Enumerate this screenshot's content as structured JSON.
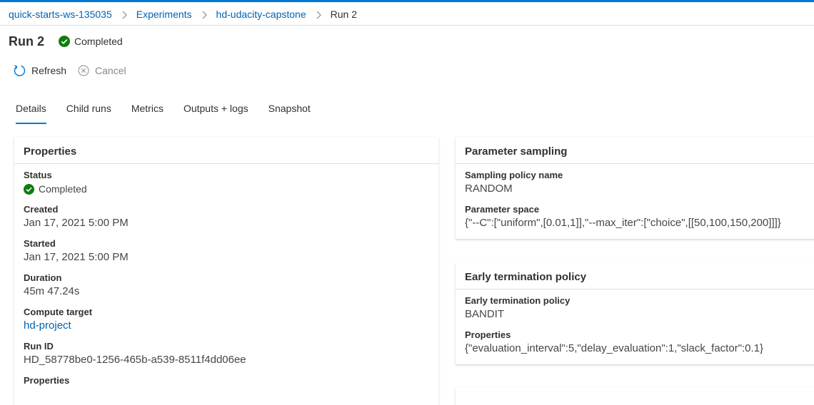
{
  "breadcrumb": {
    "items": [
      {
        "label": "quick-starts-ws-135035"
      },
      {
        "label": "Experiments"
      },
      {
        "label": "hd-udacity-capstone"
      }
    ],
    "current": "Run 2"
  },
  "header": {
    "title": "Run 2",
    "status": "Completed"
  },
  "commands": {
    "refresh": "Refresh",
    "cancel": "Cancel"
  },
  "tabs": [
    {
      "label": "Details",
      "active": true
    },
    {
      "label": "Child runs"
    },
    {
      "label": "Metrics"
    },
    {
      "label": "Outputs + logs"
    },
    {
      "label": "Snapshot"
    }
  ],
  "properties": {
    "heading": "Properties",
    "status_label": "Status",
    "status_value": "Completed",
    "created_label": "Created",
    "created_value": "Jan 17, 2021 5:00 PM",
    "started_label": "Started",
    "started_value": "Jan 17, 2021 5:00 PM",
    "duration_label": "Duration",
    "duration_value": "45m 47.24s",
    "compute_label": "Compute target",
    "compute_value": "hd-project",
    "runid_label": "Run ID",
    "runid_value": "HD_58778be0-1256-465b-a539-8511f4dd06ee",
    "next_label": "Properties"
  },
  "sampling": {
    "heading": "Parameter sampling",
    "policy_label": "Sampling policy name",
    "policy_value": "RANDOM",
    "space_label": "Parameter space",
    "space_value": "{\"--C\":[\"uniform\",[0.01,1]],\"--max_iter\":[\"choice\",[[50,100,150,200]]]}"
  },
  "termination": {
    "heading": "Early termination policy",
    "policy_label": "Early termination policy",
    "policy_value": "BANDIT",
    "props_label": "Properties",
    "props_value": "{\"evaluation_interval\":5,\"delay_evaluation\":1,\"slack_factor\":0.1}"
  },
  "colors": {
    "accent": "#0078d4",
    "link": "#0063b1",
    "success": "#107c10"
  }
}
